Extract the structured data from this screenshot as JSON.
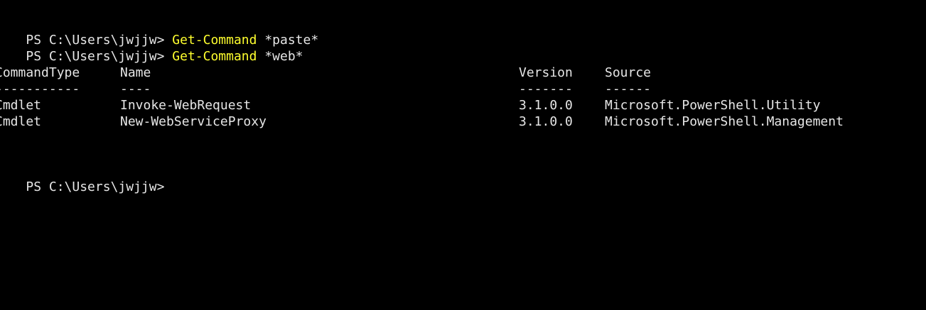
{
  "colors": {
    "background": "#000000",
    "text": "#e6e6e6",
    "command": "#ffff2e"
  },
  "history": [
    {
      "prompt": "PS C:\\Users\\jwjjw> ",
      "command": "Get-Command",
      "args": " *paste*"
    },
    {
      "prompt": "PS C:\\Users\\jwjjw> ",
      "command": "Get-Command",
      "args": " *web*"
    }
  ],
  "table": {
    "headers": [
      "CommandType",
      "Name",
      "Version",
      "Source"
    ],
    "separators": [
      "-----------",
      "----",
      "-------",
      "------"
    ],
    "rows": [
      [
        "Cmdlet",
        "Invoke-WebRequest",
        "3.1.0.0",
        "Microsoft.PowerShell.Utility"
      ],
      [
        "Cmdlet",
        "New-WebServiceProxy",
        "3.1.0.0",
        "Microsoft.PowerShell.Management"
      ]
    ]
  },
  "current_prompt": "PS C:\\Users\\jwjjw>"
}
